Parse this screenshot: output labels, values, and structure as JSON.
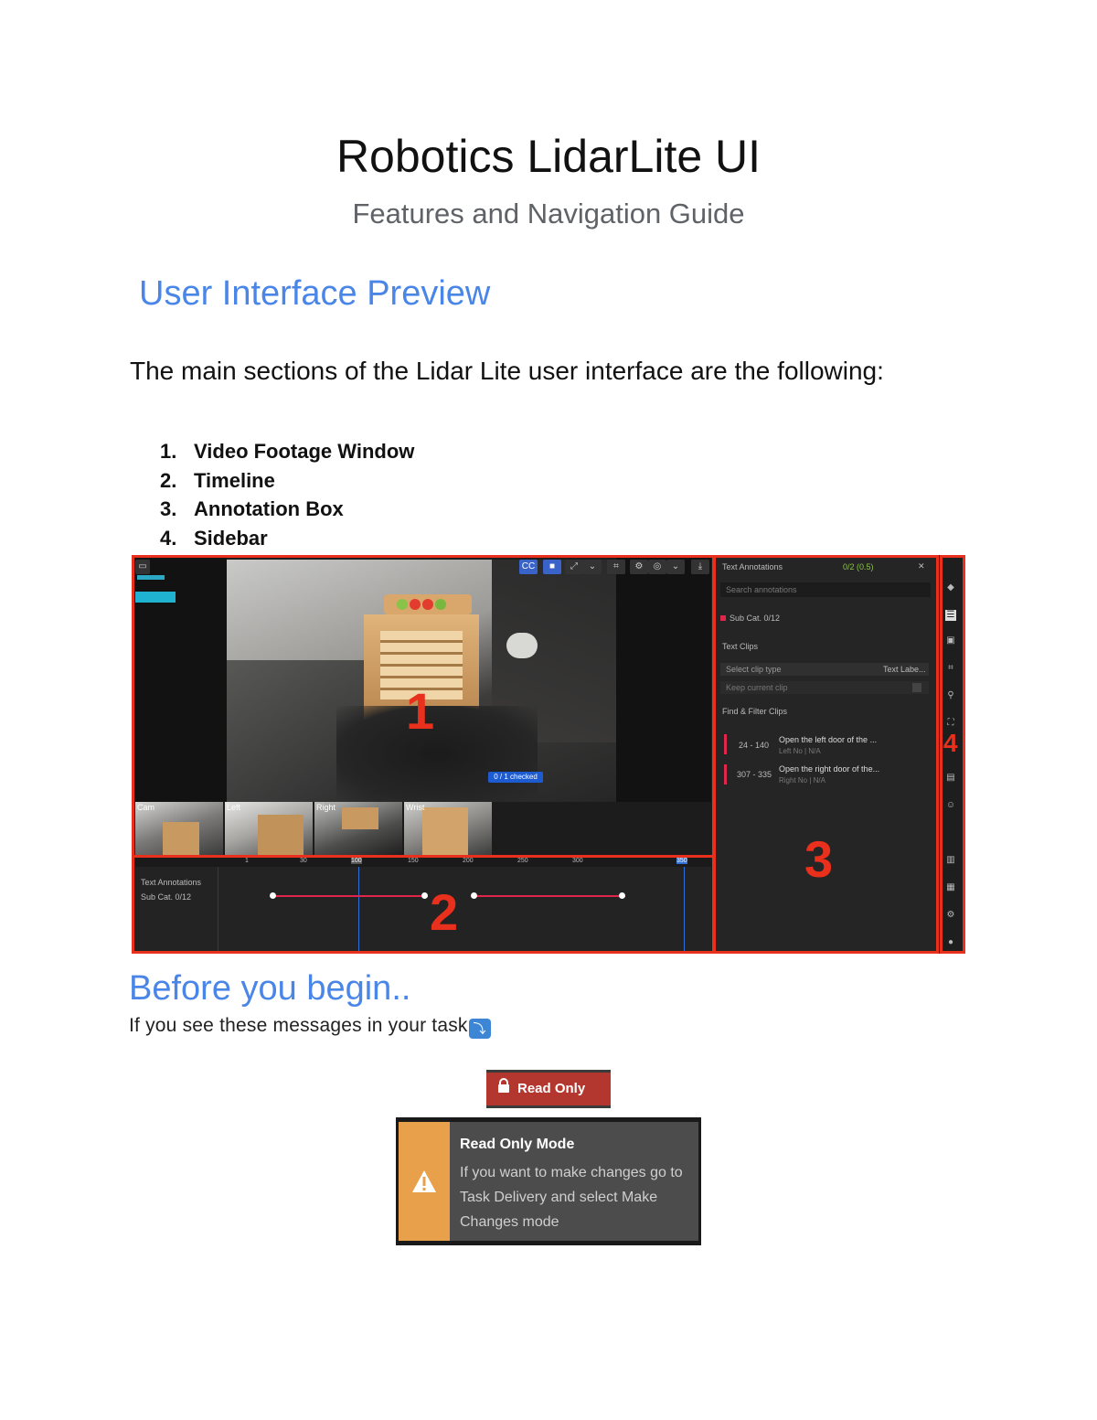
{
  "title": "Robotics LidarLite UI",
  "subtitle": "Features and Navigation Guide",
  "section1": {
    "heading": "User Interface Preview",
    "intro": "The main sections of the Lidar Lite user interface are the following:",
    "items": [
      {
        "num": "1.",
        "label": "Video Footage Window"
      },
      {
        "num": "2.",
        "label": "Timeline"
      },
      {
        "num": "3.",
        "label": "Annotation Box"
      },
      {
        "num": "4.",
        "label": "Sidebar"
      }
    ]
  },
  "preview": {
    "markers": [
      "1",
      "2",
      "3",
      "4"
    ],
    "panel": {
      "header": "Text Annotations",
      "counter": "0/2 (0.5)",
      "search_placeholder": "Search annotations",
      "sub_item": "Sub Cat. 0/12",
      "clips_label": "Text Clips",
      "select_placeholder": "Select clip type",
      "select_right": "Text Labe...",
      "checkbox_label": "Keep current clip",
      "find_filter": "Find & Filter Clips",
      "clips": [
        {
          "range": "24 - 140",
          "title": "Open the left door of the ...",
          "sub": "Left  No | N/A"
        },
        {
          "range": "307 - 335",
          "title": "Open the right door of the...",
          "sub": "Right  No | N/A"
        }
      ]
    },
    "timeline": {
      "track_header": "Text Annotations",
      "track_item": "Sub Cat. 0/12",
      "ticks": [
        "1",
        "30",
        "100",
        "150",
        "200",
        "250",
        "300",
        "350"
      ]
    },
    "video": {
      "badge": "0 / 1 checked",
      "thumb_labels": [
        "Cam",
        "Left",
        "Right",
        "Wrist"
      ]
    },
    "colors": {
      "annotation_outline": "#e8301c",
      "ui_background": "#1c1c1c",
      "accent_blue": "#2f6fd8"
    }
  },
  "section2": {
    "heading": "Before you begin..",
    "note": "If you see these messages in your task",
    "note_icon": "arrow-turn-down-emoji"
  },
  "read_only_badge": {
    "label": "Read Only",
    "icon": "lock-icon",
    "color": "#b3372e"
  },
  "toast": {
    "title": "Read Only Mode",
    "body": "If you want to make changes go to Task Delivery and select Make Changes mode",
    "icon": "warning-icon",
    "accent": "#e8a04a"
  }
}
